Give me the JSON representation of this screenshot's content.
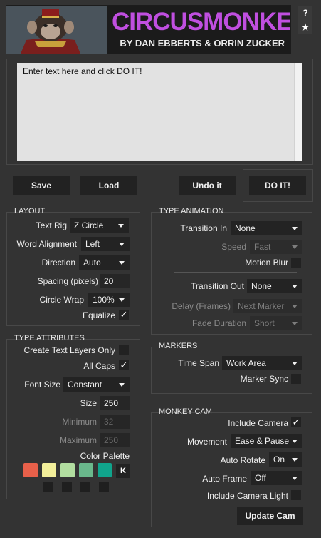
{
  "header": {
    "title": "CIRCUSMONKEY",
    "subtitle": "BY DAN EBBERTS & ORRIN ZUCKER",
    "help_label": "?",
    "star_label": "★"
  },
  "text_input": {
    "value": "Enter text here and click DO IT!"
  },
  "actions": {
    "save": "Save",
    "load": "Load",
    "undo": "Undo it",
    "do_it": "DO IT!"
  },
  "layout": {
    "title": "LAYOUT",
    "text_rig_label": "Text Rig",
    "text_rig_value": "Z Circle",
    "word_alignment_label": "Word Alignment",
    "word_alignment_value": "Left",
    "direction_label": "Direction",
    "direction_value": "Auto",
    "spacing_label": "Spacing (pixels)",
    "spacing_value": "20",
    "circle_wrap_label": "Circle Wrap",
    "circle_wrap_value": "100%",
    "equalize_label": "Equalize",
    "equalize_checked": "✓"
  },
  "type_attributes": {
    "title": "TYPE ATTRIBUTES",
    "create_text_layers_label": "Create Text Layers Only",
    "all_caps_label": "All Caps",
    "all_caps_checked": "✓",
    "font_size_label": "Font Size",
    "font_size_value": "Constant",
    "size_label": "Size",
    "size_value": "250",
    "minimum_label": "Minimum",
    "minimum_value": "32",
    "maximum_label": "Maximum",
    "maximum_value": "250",
    "color_palette_label": "Color Palette",
    "colors": [
      "#e8604a",
      "#f3ef9a",
      "#b2dea0",
      "#6ab88c",
      "#10a48c"
    ],
    "k_label": "K"
  },
  "type_animation": {
    "title": "TYPE ANIMATION",
    "transition_in_label": "Transition In",
    "transition_in_value": "None",
    "speed_label": "Speed",
    "speed_value": "Fast",
    "motion_blur_label": "Motion Blur",
    "transition_out_label": "Transition Out",
    "transition_out_value": "None",
    "delay_label": "Delay (Frames)",
    "delay_value": "Next Marker",
    "fade_duration_label": "Fade Duration",
    "fade_duration_value": "Short"
  },
  "markers": {
    "title": "MARKERS",
    "time_span_label": "Time Span",
    "time_span_value": "Work Area",
    "marker_sync_label": "Marker Sync"
  },
  "monkey_cam": {
    "title": "MONKEY CAM",
    "include_camera_label": "Include Camera",
    "include_camera_checked": "✓",
    "movement_label": "Movement",
    "movement_value": "Ease & Pause",
    "auto_rotate_label": "Auto Rotate",
    "auto_rotate_value": "On",
    "auto_frame_label": "Auto Frame",
    "auto_frame_value": "Off",
    "include_light_label": "Include Camera Light",
    "update_cam_label": "Update Cam"
  }
}
